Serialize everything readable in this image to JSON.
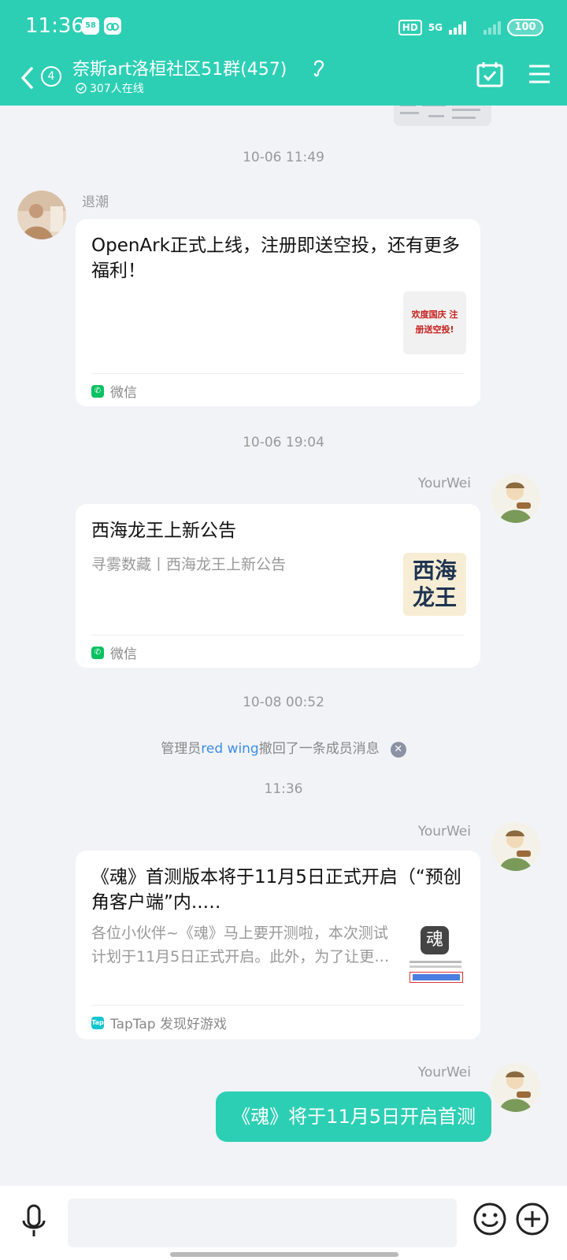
{
  "status_bar": {
    "time": "11:36",
    "app_badge_1": "58",
    "hd": "HD",
    "network": "5G",
    "battery": "100"
  },
  "header": {
    "back_count": "4",
    "title": "奈斯art洛桓社区51群(457)",
    "online": "307人在线"
  },
  "messages": [
    {
      "type": "timestamp",
      "text": "10-06 11:49"
    },
    {
      "type": "card",
      "sender": "退潮",
      "side": "left",
      "title": "OpenArk正式上线，注册即送空投，还有更多福利！",
      "thumb_text": "欢度国庆 注册送空投!",
      "source": "微信"
    },
    {
      "type": "timestamp",
      "text": "10-06 19:04"
    },
    {
      "type": "card",
      "sender": "YourWei",
      "side": "right",
      "title": "西海龙王上新公告",
      "desc": "寻雾数藏丨西海龙王上新公告",
      "thumb_text_1": "西海",
      "thumb_text_2": "龙王",
      "source": "微信"
    },
    {
      "type": "timestamp",
      "text": "10-08 00:52"
    },
    {
      "type": "recall",
      "prefix": "管理员",
      "admin": "red wing",
      "suffix": "撤回了一条成员消息"
    },
    {
      "type": "timestamp",
      "text": "11:36"
    },
    {
      "type": "card",
      "sender": "YourWei",
      "side": "right",
      "title": "《魂》首测版本将于11月5日正式开启（“预创角客户端”内..…",
      "desc": "各位小伙伴~《魂》马上要开测啦，本次测试计划于11月5日正式开启。此外，为了让更…",
      "thumb_text": "魂",
      "source": "TapTap 发现好游戏"
    },
    {
      "type": "text",
      "sender": "YourWei",
      "side": "right",
      "text": "《魂》将于11月5日开启首测"
    }
  ],
  "input": {
    "placeholder": ""
  },
  "colors": {
    "accent": "#2dcfb4",
    "link": "#3a8ee6",
    "background": "#f2f3f7"
  }
}
